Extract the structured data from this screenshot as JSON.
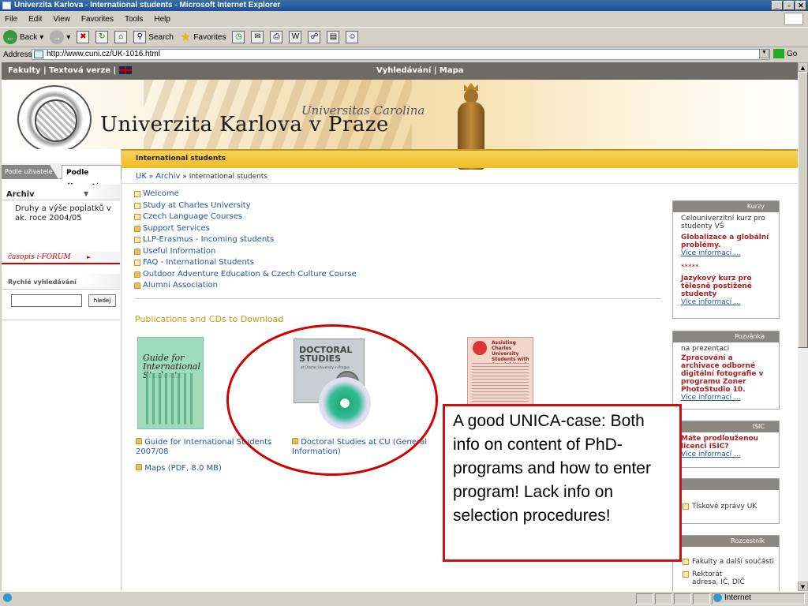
{
  "window": {
    "title": "Univerzita Karlova - International students - Microsoft Internet Explorer"
  },
  "menu": [
    "File",
    "Edit",
    "View",
    "Favorites",
    "Tools",
    "Help"
  ],
  "toolbar": {
    "back": "Back",
    "search": "Search",
    "favorites": "Favorites"
  },
  "address": {
    "label": "Address",
    "url": "http://www.cuni.cz/UK-1016.html",
    "go": "Go"
  },
  "site": {
    "topnav_left": "Fakulty | Textová verze |",
    "topnav_right": "Vyhledávání | Mapa",
    "title": "Univerzita Karlova v Praze",
    "subtitle": "Universitas Carolina",
    "section": "International students",
    "breadcrumb": {
      "home": "UK",
      "archiv": "Archiv",
      "sep1": "»",
      "sep2": "»",
      "current": "International students"
    }
  },
  "left": {
    "tab1": "Podle uživatele",
    "tab2": "Podle činností",
    "archiv": "Archiv",
    "archiv_item": "Druhy a výše poplatků v ak. roce 2004/05",
    "casopis": "časopis i-FORUM",
    "quick_search": "Rychlé vyhledávání",
    "search_btn": "hledej"
  },
  "menu_items": [
    "Welcome",
    "Study at Charles University",
    "Czech Language Courses",
    "Support Services",
    "LLP-Erasmus - Incoming students",
    "Useful Information",
    "FAQ - International Students",
    "Outdoor Adventure Education & Czech Culture Course",
    "Alumni Association"
  ],
  "publications": {
    "heading": "Publications and CDs to Download",
    "book1_cover": "Guide for International Students",
    "book2_cover": "DOCTORAL STUDIES",
    "book2_sub": "at Charles University in Prague",
    "book3_cover": "Assisting Charles University Students with Special Needs",
    "item1": "Guide for International Students 2007/08",
    "item2": "Doctoral Studies at CU (General Information)",
    "item3": "Maps (PDF, 8.0 MB)"
  },
  "callout": "A good UNICA-case: Both info on content of PhD-programs and how to enter program! Lack info on selection procedures!",
  "right": {
    "kurzy": {
      "header": "Kurzy",
      "intro": "Celouniverzitní kurz pro studenty VŠ",
      "b1": "Globalizace a globální problémy.",
      "more1": "Více informací ...",
      "ast": "*****",
      "b2": "Jazykový kurz pro tělesně postižené studenty",
      "more2": "Více informací ..."
    },
    "pozvanka": {
      "header": "Pozvánka",
      "intro": "na prezentaci",
      "b1": "Zpracování a archivace odborné digitální fotografie v programu Zoner PhotoStudio 10.",
      "more": "Více informací ..."
    },
    "isic": {
      "header": "ISIC",
      "b1": "Máte prodlouženou licenci ISIC?",
      "more": "Více informací ..."
    },
    "tisk": {
      "link": "Tiskové zprávy UK"
    },
    "rozcestnik": {
      "header": "Rozcestník",
      "l1": "Fakulty a další součásti",
      "l2": "Rektorát",
      "l3": "adresa, IČ, DIČ"
    }
  },
  "status": {
    "zone": "Internet"
  }
}
